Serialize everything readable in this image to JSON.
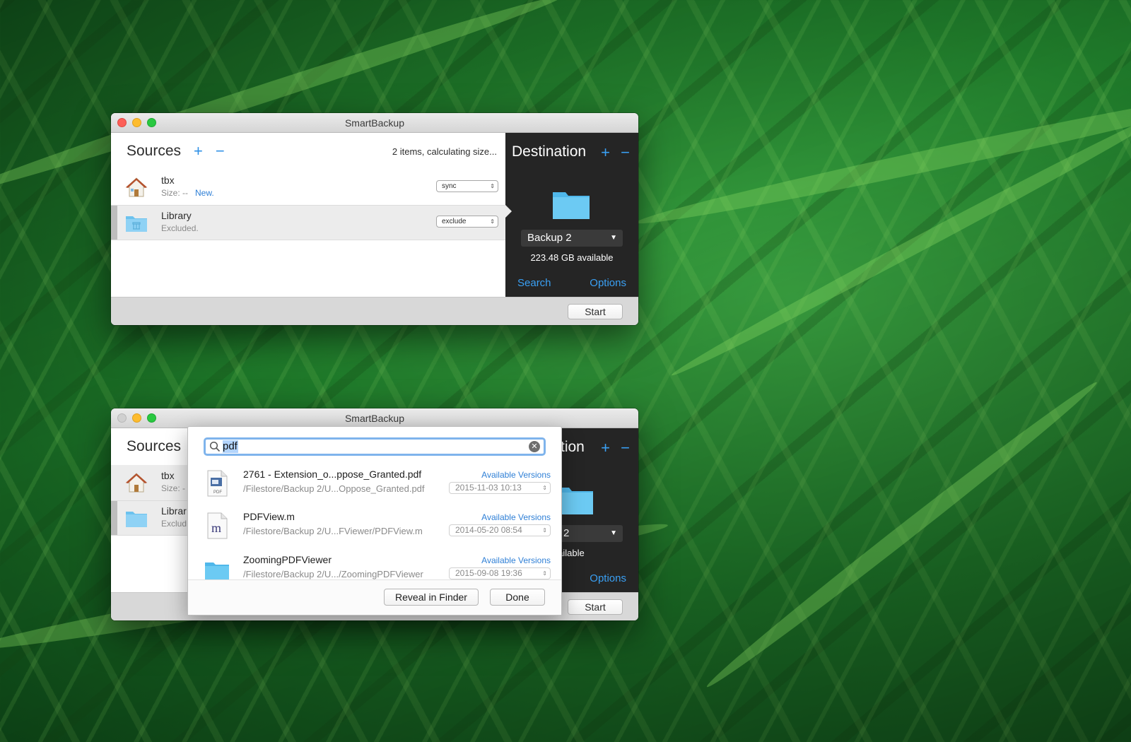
{
  "colors": {
    "accent": "#2e90e6",
    "dest_bg": "#252525"
  },
  "window_top": {
    "title": "SmartBackup",
    "sources_title": "Sources",
    "plus": "+",
    "minus": "−",
    "status": "2 items, calculating size...",
    "rows": [
      {
        "name": "tbx",
        "sub": "Size: --",
        "badge": "New.",
        "mode": "sync",
        "icon": "home-icon"
      },
      {
        "name": "Library",
        "sub": "Excluded.",
        "mode": "exclude",
        "icon": "folder-icon"
      }
    ],
    "destination": {
      "title": "Destination",
      "plus": "+",
      "minus": "−",
      "volume": "Backup 2",
      "available": "223.48 GB available",
      "search": "Search",
      "options": "Options"
    },
    "start": "Start"
  },
  "window_bottom": {
    "title": "SmartBackup",
    "sources_title": "Sources",
    "rows": [
      {
        "name": "tbx",
        "sub": "Size: -"
      },
      {
        "name": "Librar",
        "sub": "Exclud"
      }
    ],
    "dest_title_partial": "tion",
    "plus": "+",
    "minus": "−",
    "volume_partial": "2",
    "available_partial": "GB available",
    "options": "Options",
    "start": "Start"
  },
  "search_popover": {
    "query": "pdf",
    "results": [
      {
        "name": "2761 - Extension_o...ppose_Granted.pdf",
        "path": "/Filestore/Backup 2/U...Oppose_Granted.pdf",
        "versions": "Available Versions",
        "date": "2015-11-03 10:13",
        "icon": "pdf-file-icon"
      },
      {
        "name": "PDFView.m",
        "path": "/Filestore/Backup 2/U...FViewer/PDFView.m",
        "versions": "Available Versions",
        "date": "2014-05-20 08:54",
        "icon": "m-file-icon"
      },
      {
        "name": "ZoomingPDFViewer",
        "path": "/Filestore/Backup 2/U.../ZoomingPDFViewer",
        "versions": "Available Versions",
        "date": "2015-09-08 19:36",
        "icon": "folder-icon"
      }
    ],
    "reveal": "Reveal in Finder",
    "done": "Done"
  }
}
